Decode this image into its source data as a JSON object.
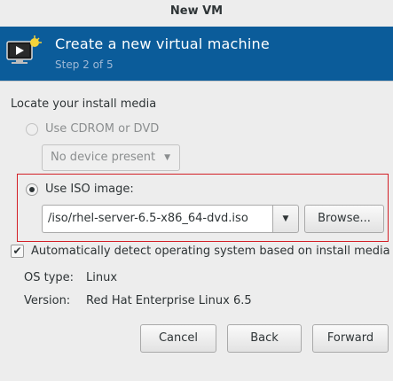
{
  "window": {
    "title": "New VM"
  },
  "banner": {
    "title": "Create a new virtual machine",
    "subtitle": "Step 2 of 5",
    "icon": "monitor-play-icon",
    "color": "#0b5c9a"
  },
  "install_media": {
    "section_label": "Locate your install media",
    "cdrom_label": "Use CDROM or DVD",
    "cdrom_selected": false,
    "cdrom_device": "No device present",
    "iso_label": "Use ISO image:",
    "iso_selected": true,
    "iso_path": "/iso/rhel-server-6.5-x86_64-dvd.iso",
    "browse_label": "Browse...",
    "highlight_color": "#d31f26"
  },
  "os_detect": {
    "auto_detect_label": "Automatically detect operating system based on install media",
    "auto_detect_checked": true,
    "os_type_label": "OS type:",
    "os_type_value": "Linux",
    "version_label": "Version:",
    "version_value": "Red Hat Enterprise Linux 6.5"
  },
  "footer": {
    "cancel_label": "Cancel",
    "back_label": "Back",
    "forward_label": "Forward"
  }
}
